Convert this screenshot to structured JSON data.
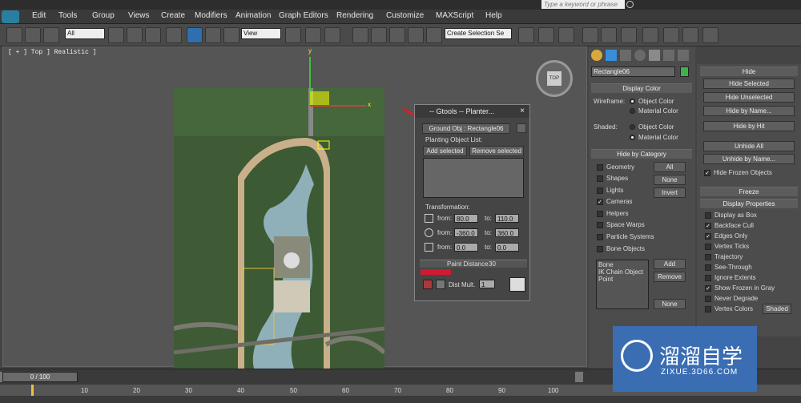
{
  "titlebar": {
    "help_search_placeholder": "Type a keyword or phrase"
  },
  "menu": [
    "Edit",
    "Tools",
    "Group",
    "Views",
    "Create",
    "Modifiers",
    "Animation",
    "Graph Editors",
    "Rendering",
    "Customize",
    "MAXScript",
    "Help"
  ],
  "toolbar": {
    "selection_filter": "All",
    "ref_coord": "View",
    "selection_set": "Create Selection Se"
  },
  "viewport": {
    "label": "[ + ] Top ] Realistic ]",
    "axis_y": "y",
    "axis_x": "x",
    "viewcube_label": "TOP"
  },
  "gtools": {
    "title": "-- Gtools -- Planter...",
    "ground_obj_button": "Ground Obj : Rectangle06",
    "planting_list_label": "Planting Object List:",
    "add_selected": "Add selected",
    "remove_selected": "Remove selected",
    "transformation_label": "Transformation:",
    "rows": [
      {
        "from_label": "from:",
        "from": "80.0",
        "to_label": "to:",
        "to": "110.0"
      },
      {
        "from_label": "from:",
        "from": "-360.0",
        "to_label": "to:",
        "to": "360.0"
      },
      {
        "from_label": "from:",
        "from": "0.0",
        "to_label": "to:",
        "to": "0.0"
      }
    ],
    "paint_distance_label": "Paint Distance",
    "paint_distance_value": "30",
    "dist_mult_label": "Dist Mult.",
    "dist_mult_value": "1"
  },
  "command_panel": {
    "object_name": "Rectangle06",
    "object_color": "#3fb34a",
    "display_color": {
      "title": "Display Color",
      "wireframe_label": "Wireframe:",
      "shaded_label": "Shaded:",
      "object_color": "Object Color",
      "material_color": "Material Color"
    },
    "hide_by_category": {
      "title": "Hide by Category",
      "items": [
        {
          "label": "Geometry",
          "checked": false
        },
        {
          "label": "Shapes",
          "checked": false
        },
        {
          "label": "Lights",
          "checked": false
        },
        {
          "label": "Cameras",
          "checked": true
        },
        {
          "label": "Helpers",
          "checked": false
        },
        {
          "label": "Space Warps",
          "checked": false
        },
        {
          "label": "Particle Systems",
          "checked": false
        },
        {
          "label": "Bone Objects",
          "checked": false
        }
      ],
      "all_btn": "All",
      "none_btn": "None",
      "invert_btn": "Invert",
      "list": [
        "Bone",
        "IK Chain Object",
        "Point"
      ],
      "add_btn": "Add",
      "remove_btn": "Remove",
      "none2_btn": "None"
    }
  },
  "right_panel": {
    "hide_title": "Hide",
    "hide_buttons": [
      "Hide Selected",
      "Hide Unselected",
      "Hide by Name...",
      "Hide by Hit"
    ],
    "unhide_buttons": [
      "Unhide All",
      "Unhide by Name..."
    ],
    "hide_frozen_label": "Hide Frozen Objects",
    "freeze_title": "Freeze",
    "display_props_title": "Display Properties",
    "display_props": [
      {
        "label": "Display as Box",
        "checked": false
      },
      {
        "label": "Backface Cull",
        "checked": true
      },
      {
        "label": "Edges Only",
        "checked": true
      },
      {
        "label": "Vertex Ticks",
        "checked": false
      },
      {
        "label": "Trajectory",
        "checked": false
      },
      {
        "label": "See-Through",
        "checked": false
      },
      {
        "label": "Ignore Extents",
        "checked": false
      },
      {
        "label": "Show Frozen in Gray",
        "checked": true
      },
      {
        "label": "Never Degrade",
        "checked": false
      },
      {
        "label": "Vertex Colors",
        "checked": false
      }
    ],
    "shaded_btn": "Shaded"
  },
  "timeline": {
    "frame_label": "0 / 100",
    "ticks": [
      "10",
      "20",
      "30",
      "40",
      "50",
      "60",
      "70",
      "80",
      "90",
      "100"
    ]
  },
  "watermark": {
    "brand": "溜溜自学",
    "url": "ZIXUE.3D66.COM"
  }
}
